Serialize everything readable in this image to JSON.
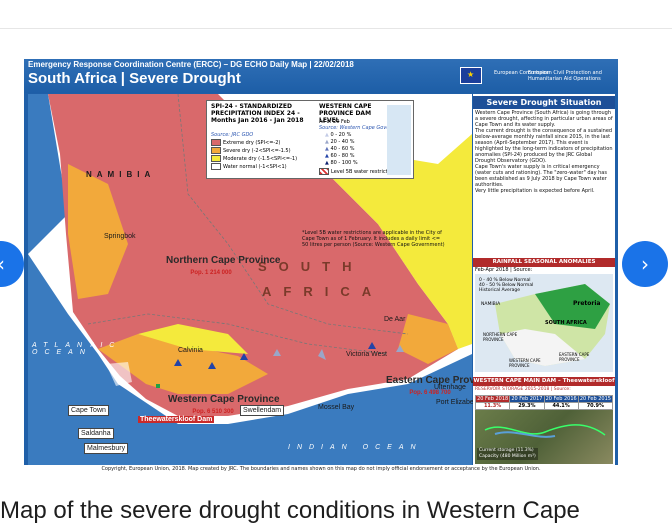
{
  "header": {
    "line1": "Emergency Response Coordination Centre (ERCC) – DG ECHO Daily Map | 22/02/2018",
    "title": "South Africa | Severe Drought",
    "eu_label_1": "European Commission",
    "eu_label_2": "European Civil Protection and Humanitarian Aid Operations"
  },
  "map_labels": {
    "namibia": "NAMIBIA",
    "south": "SOUTH",
    "africa": "AFRICA",
    "atlantic": "ATLANTIC OCEAN",
    "indian": "INDIAN OCEAN",
    "northern_cape": "Northern Cape Province",
    "northern_cape_pop": "Pop. 1 214 000",
    "western_cape": "Western Cape Province",
    "western_cape_pop": "Pop. 6 510 300",
    "eastern_cape": "Eastern Cape Province",
    "eastern_cape_pop": "Pop. 6 498 700",
    "dam_name": "Theewaterskloof Dam",
    "cities": [
      "Springbok",
      "Calvinia",
      "Victoria West",
      "De Aar",
      "Saldanha",
      "Malmesbury",
      "Cape Town",
      "Swellendam",
      "Mossel Bay",
      "Uitenhage",
      "Port Elizabeth"
    ],
    "note": "*Level 5B water restrictions are applicable in the City of Cape Town as of 1 February. It includes a daily limit <= 50 litres per person (Source: Western Cape Government)"
  },
  "legend": {
    "spi_title": "SPI-24 - STANDARDIZED PRECIPITATION INDEX 24 - Months Jan 2016 - Jan 2018",
    "spi_source": "Source: JRC GDO",
    "spi_items": [
      {
        "label": "Extreme dry (SPI<=-2)",
        "color": "#d9696b"
      },
      {
        "label": "Severe dry (-2<SPI<=-1.5)",
        "color": "#f2a93b"
      },
      {
        "label": "Moderate dry (-1.5<SPI<=-1)",
        "color": "#f4ea3c"
      },
      {
        "label": "Water normal (-1<SPI<1)",
        "color": "#ffffff"
      }
    ],
    "dam_title": "WESTERN CAPE PROVINCE DAM LEVEL",
    "dam_sub": "As of 20 Feb",
    "dam_source": "Source: Western Cape Government",
    "dam_items": [
      "0 - 20 %",
      "20 - 40 %",
      "40 - 60 %",
      "60 - 80 %",
      "80 - 100 %"
    ],
    "restriction": "Level 5B water restriction*"
  },
  "sidebar": {
    "title": "Severe Drought Situation",
    "bullets": [
      "Western Cape Province (South Africa) is going through a severe drought, affecting in particular urban areas of Cape Town and its water supply.",
      "The current drought is the consequence of a sustained below-average monthly rainfall since 2015, in the last season (April-September 2017). This event is highlighted by the long-term indicators of precipitation anomalies (SPI-24) produced by the JRC Global Drought Observatory (GDO).",
      "Cape Town's water supply is in critical emergency (water cuts and rationing). The \"zero-water\" day has been established as 9 July 2018 by Cape Town water authorities.",
      "Very little precipitation is expected before April."
    ],
    "rain_title": "RAINFALL SEASONAL ANOMALIES",
    "rain_sub": "Feb-Apr 2018 | Source:",
    "rain_items": [
      "0 - 40 % Below Normal",
      "40 - 50 % Below Normal",
      "Historical Average"
    ],
    "inset_labels": [
      "Pretoria",
      "NAMIBIA",
      "SOUTH AFRICA",
      "NORTHERN CAPE PROVINCE",
      "EASTERN CAPE PROVINCE",
      "WESTERN CAPE PROVINCE"
    ],
    "dam_title": "WESTERN CAPE MAIN DAM – Theewaterskloof",
    "dam_sub": "RESERVOIR STORAGE 2015-2018 | Source:",
    "dam_cols": [
      "20 Feb 2018",
      "20 Feb 2017",
      "20 Feb 2016",
      "20 Feb 2015"
    ],
    "dam_vals": [
      "11.3%",
      "29.3%",
      "44.1%",
      "70.9%"
    ],
    "photo_legend": [
      "Current storage (11.3%)",
      "Capacity (480 Million m³)"
    ]
  },
  "footer": "Copyright, European Union, 2018. Map created by JRC. The boundaries and names shown on this map do not imply official endorsement or acceptance by the European Union.",
  "nav": {
    "prev": "‹",
    "next": "›"
  },
  "caption": "Map of the severe drought conditions in Western Cape"
}
